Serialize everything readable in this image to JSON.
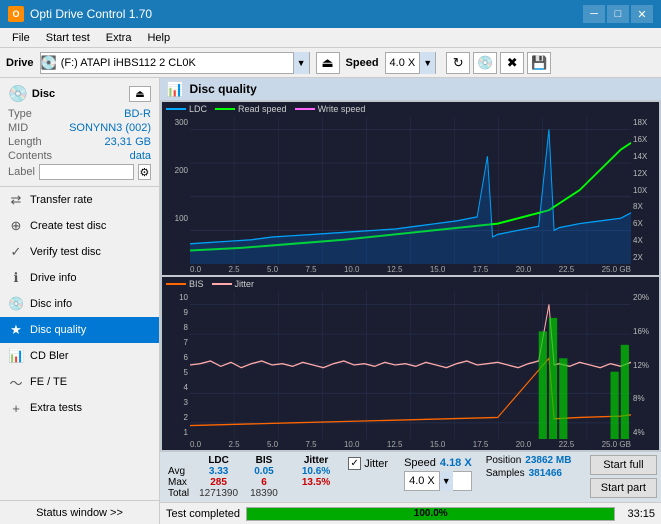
{
  "app": {
    "title": "Opti Drive Control 1.70",
    "icon_label": "O"
  },
  "titlebar": {
    "minimize_label": "─",
    "maximize_label": "□",
    "close_label": "✕"
  },
  "menu": {
    "items": [
      "File",
      "Start test",
      "Extra",
      "Help"
    ]
  },
  "drivebar": {
    "drive_label": "Drive",
    "drive_value": "(F:)  ATAPI iHBS112  2 CL0K",
    "speed_label": "Speed",
    "speed_value": "4.0 X"
  },
  "disc": {
    "header": "Disc",
    "type_label": "Type",
    "type_value": "BD-R",
    "mid_label": "MID",
    "mid_value": "SONYNN3 (002)",
    "length_label": "Length",
    "length_value": "23,31 GB",
    "contents_label": "Contents",
    "contents_value": "data",
    "label_label": "Label",
    "label_value": ""
  },
  "nav": {
    "items": [
      {
        "id": "transfer-rate",
        "label": "Transfer rate",
        "icon": "⇄"
      },
      {
        "id": "create-test-disc",
        "label": "Create test disc",
        "icon": "⊕"
      },
      {
        "id": "verify-test-disc",
        "label": "Verify test disc",
        "icon": "✓"
      },
      {
        "id": "drive-info",
        "label": "Drive info",
        "icon": "ℹ"
      },
      {
        "id": "disc-info",
        "label": "Disc info",
        "icon": "💿"
      },
      {
        "id": "disc-quality",
        "label": "Disc quality",
        "icon": "★",
        "active": true
      },
      {
        "id": "cd-bler",
        "label": "CD Bler",
        "icon": "📊"
      },
      {
        "id": "fe-te",
        "label": "FE / TE",
        "icon": "~"
      },
      {
        "id": "extra-tests",
        "label": "Extra tests",
        "icon": "+"
      }
    ],
    "status_window": "Status window >>"
  },
  "chart": {
    "title": "Disc quality",
    "top_legend": [
      "LDC",
      "Read speed",
      "Write speed"
    ],
    "bottom_legend": [
      "BIS",
      "Jitter"
    ],
    "top_y_labels": [
      "18X",
      "16X",
      "14X",
      "12X",
      "10X",
      "8X",
      "6X",
      "4X",
      "2X"
    ],
    "top_y_left": [
      "300",
      "200",
      "100"
    ],
    "bottom_y_left": [
      "10",
      "9",
      "8",
      "7",
      "6",
      "5",
      "4",
      "3",
      "2",
      "1"
    ],
    "bottom_y_right": [
      "20%",
      "16%",
      "12%",
      "8%",
      "4%"
    ],
    "x_labels": [
      "0.0",
      "2.5",
      "5.0",
      "7.5",
      "10.0",
      "12.5",
      "15.0",
      "17.5",
      "20.0",
      "22.5",
      "25.0 GB"
    ]
  },
  "stats": {
    "headers": [
      "",
      "LDC",
      "BIS",
      "",
      "Jitter",
      "Speed",
      ""
    ],
    "avg_label": "Avg",
    "avg_ldc": "3.33",
    "avg_bis": "0.05",
    "avg_jitter": "10.6%",
    "avg_speed": "4.18 X",
    "max_label": "Max",
    "max_ldc": "285",
    "max_bis": "6",
    "max_jitter": "13.5%",
    "total_label": "Total",
    "total_ldc": "1271390",
    "total_bis": "18390",
    "position_label": "Position",
    "position_value": "23862 MB",
    "samples_label": "Samples",
    "samples_value": "381466",
    "speed_select": "4.0 X",
    "jitter_label": "Jitter",
    "start_full_label": "Start full",
    "start_part_label": "Start part"
  },
  "bottom": {
    "status_text": "Test completed",
    "progress_percent": "100.0%",
    "time": "33:15"
  }
}
